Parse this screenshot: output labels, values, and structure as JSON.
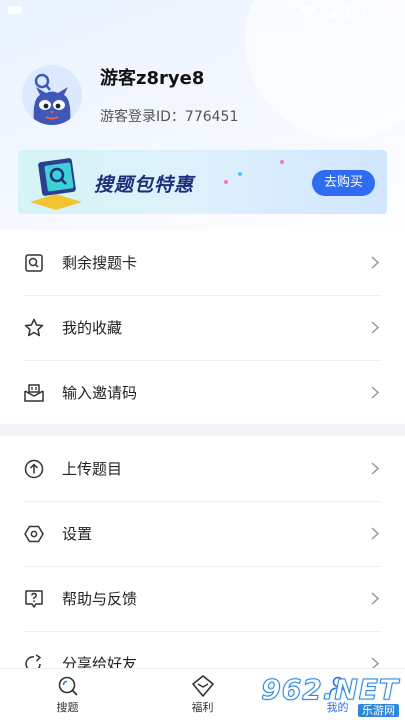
{
  "status_bar": {
    "time": "10:32"
  },
  "profile": {
    "username": "游客z8rye8",
    "guest_id": "游客登录ID：776451"
  },
  "banner": {
    "title": "搜题包特惠",
    "button": "去购买"
  },
  "menu_group_1": [
    {
      "label": "剩余搜题卡",
      "icon": "search-card-icon"
    },
    {
      "label": "我的收藏",
      "icon": "star-icon"
    },
    {
      "label": "输入邀请码",
      "icon": "invite-code-icon"
    }
  ],
  "menu_group_2": [
    {
      "label": "上传题目",
      "icon": "upload-icon"
    },
    {
      "label": "设置",
      "icon": "settings-icon"
    },
    {
      "label": "帮助与反馈",
      "icon": "help-icon"
    },
    {
      "label": "分享给好友",
      "icon": "share-icon"
    }
  ],
  "tabbar": {
    "tabs": [
      {
        "label": "搜题"
      },
      {
        "label": "福利"
      },
      {
        "label": "我的"
      }
    ]
  },
  "watermark": {
    "main": "962.NET",
    "sub": "乐游网"
  },
  "colors": {
    "accent": "#2f6cf3",
    "banner_title": "#1c2f7a",
    "watermark": "#2f86d6"
  }
}
